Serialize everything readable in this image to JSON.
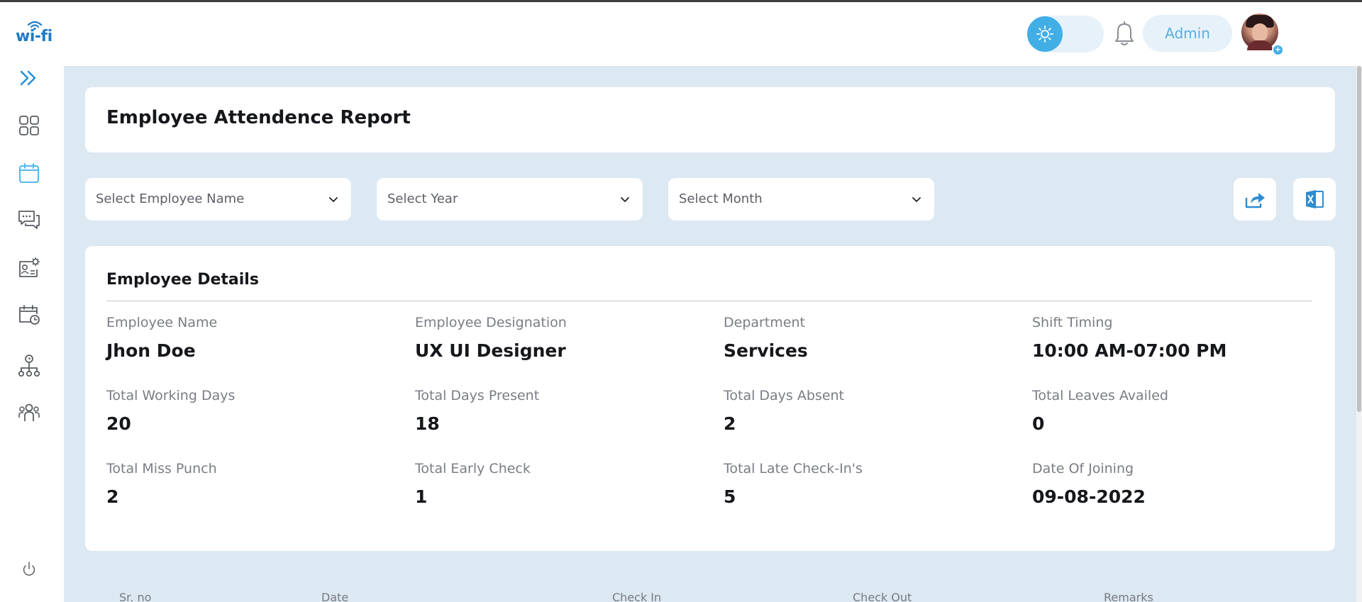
{
  "brand": {
    "logo_text": "wi-fi",
    "accent": "#42aee6",
    "logo_color": "#1f7bc8"
  },
  "sidebar": {
    "items": [
      {
        "name": "expand",
        "icon": "double-chevron-right-icon"
      },
      {
        "name": "dashboard",
        "icon": "grid-icon"
      },
      {
        "name": "attendance",
        "icon": "calendar-icon",
        "active": true
      },
      {
        "name": "messages",
        "icon": "chat-icon"
      },
      {
        "name": "employee-settings",
        "icon": "id-card-gear-icon"
      },
      {
        "name": "schedule",
        "icon": "calendar-clock-icon"
      },
      {
        "name": "organization",
        "icon": "org-chart-icon"
      },
      {
        "name": "teams",
        "icon": "people-icon"
      },
      {
        "name": "logout",
        "icon": "power-icon"
      }
    ]
  },
  "header": {
    "theme_icon": "sun-icon",
    "notification_icon": "bell-icon",
    "user_label": "Admin",
    "avatar_badge": "+",
    "menu_icon": "chevron-down-icon"
  },
  "page": {
    "title": "Employee Attendence Report"
  },
  "filters": {
    "employee_placeholder": "Select Employee Name",
    "year_placeholder": "Select Year",
    "month_placeholder": "Select Month"
  },
  "actions": {
    "share_icon": "share-icon",
    "excel_icon": "excel-icon"
  },
  "details": {
    "title": "Employee Details",
    "fields": [
      {
        "label": "Employee Name",
        "value": "Jhon Doe"
      },
      {
        "label": "Employee Designation",
        "value": "UX UI Designer"
      },
      {
        "label": "Department",
        "value": "Services"
      },
      {
        "label": "Shift Timing",
        "value": "10:00 AM-07:00 PM"
      },
      {
        "label": "Total Working Days",
        "value": "20"
      },
      {
        "label": "Total Days Present",
        "value": "18"
      },
      {
        "label": "Total Days Absent",
        "value": "2"
      },
      {
        "label": "Total Leaves Availed",
        "value": "0"
      },
      {
        "label": "Total Miss Punch",
        "value": "2"
      },
      {
        "label": "Total Early Check",
        "value": "1"
      },
      {
        "label": "Total Late Check-In's",
        "value": "5"
      },
      {
        "label": "Date Of Joining",
        "value": "09-08-2022"
      }
    ]
  },
  "table": {
    "columns": [
      "Sr. no",
      "Date",
      "Check In",
      "Check Out",
      "Remarks"
    ]
  }
}
